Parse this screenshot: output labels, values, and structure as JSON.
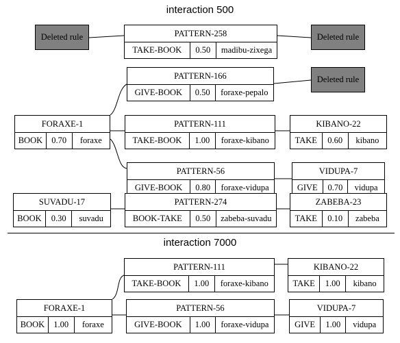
{
  "sections": [
    {
      "title": "interaction 500",
      "nodes": [
        {
          "kind": "deleted",
          "label": "Deleted rule"
        },
        {
          "kind": "pattern",
          "title": "PATTERN-258",
          "cells": [
            "TAKE-BOOK",
            "0.50",
            "madibu-zixega"
          ]
        },
        {
          "kind": "deleted",
          "label": "Deleted rule"
        },
        {
          "kind": "pattern",
          "title": "PATTERN-166",
          "cells": [
            "GIVE-BOOK",
            "0.50",
            "foraxe-pepalo"
          ]
        },
        {
          "kind": "deleted",
          "label": "Deleted rule"
        },
        {
          "kind": "agent",
          "title": "FORAXE-1",
          "cells": [
            "BOOK",
            "0.70",
            "foraxe"
          ]
        },
        {
          "kind": "pattern",
          "title": "PATTERN-111",
          "cells": [
            "TAKE-BOOK",
            "1.00",
            "foraxe-kibano"
          ]
        },
        {
          "kind": "agent",
          "title": "KIBANO-22",
          "cells": [
            "TAKE",
            "0.60",
            "kibano"
          ]
        },
        {
          "kind": "pattern",
          "title": "PATTERN-56",
          "cells": [
            "GIVE-BOOK",
            "0.80",
            "foraxe-vidupa"
          ]
        },
        {
          "kind": "agent",
          "title": "VIDUPA-7",
          "cells": [
            "GIVE",
            "0.70",
            "vidupa"
          ]
        },
        {
          "kind": "agent",
          "title": "SUVADU-17",
          "cells": [
            "BOOK",
            "0.30",
            "suvadu"
          ]
        },
        {
          "kind": "pattern",
          "title": "PATTERN-274",
          "cells": [
            "BOOK-TAKE",
            "0.50",
            "zabeba-suvadu"
          ]
        },
        {
          "kind": "agent",
          "title": "ZABEBA-23",
          "cells": [
            "TAKE",
            "0.10",
            "zabeba"
          ]
        }
      ]
    },
    {
      "title": "interaction 7000",
      "nodes": [
        {
          "kind": "pattern",
          "title": "PATTERN-111",
          "cells": [
            "TAKE-BOOK",
            "1.00",
            "foraxe-kibano"
          ]
        },
        {
          "kind": "agent",
          "title": "KIBANO-22",
          "cells": [
            "TAKE",
            "1.00",
            "kibano"
          ]
        },
        {
          "kind": "agent",
          "title": "FORAXE-1",
          "cells": [
            "BOOK",
            "1.00",
            "foraxe"
          ]
        },
        {
          "kind": "pattern",
          "title": "PATTERN-56",
          "cells": [
            "GIVE-BOOK",
            "1.00",
            "foraxe-vidupa"
          ]
        },
        {
          "kind": "agent",
          "title": "VIDUPA-7",
          "cells": [
            "GIVE",
            "1.00",
            "vidupa"
          ]
        }
      ]
    }
  ],
  "colors": {
    "deleted_fill": "#808080",
    "border": "#000000"
  }
}
